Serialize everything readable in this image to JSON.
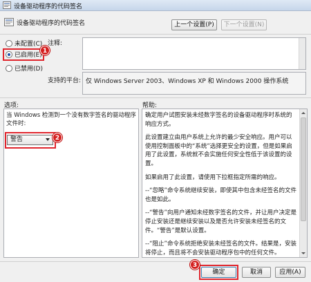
{
  "window": {
    "title": "设备驱动程序的代码签名"
  },
  "header": {
    "title": "设备驱动程序的代码签名",
    "prev_label": "上一个设置(P)",
    "next_label": "下一个设置(N)"
  },
  "state": {
    "options": [
      {
        "label": "未配置(C)",
        "checked": false
      },
      {
        "label": "已启用(E)",
        "checked": true
      },
      {
        "label": "已禁用(D)",
        "checked": false
      }
    ]
  },
  "comment": {
    "label": "注释:",
    "value": ""
  },
  "platform": {
    "label": "支持的平台:",
    "value": "仅 Windows Server 2003、Windows XP 和 Windows 2000 操作系统"
  },
  "options_panel": {
    "label": "选项:",
    "prompt": "当 Windows 检测到一个没有数字签名的驱动程序文件时:",
    "selected": "警告"
  },
  "help_panel": {
    "label": "帮助:",
    "paragraphs": [
      "确定用户试图安装未经数字签名的设备驱动程序时系统的响应方式。",
      "此设置建立由用户系统上允许的最少安全响应。用户可以使用控制面板中的“系统”选择更安全的设置，但是如果启用了此设置，系统就不会实施任何安全性低于该设置的设置。",
      "如果启用了此设置，请使用下拉框指定所需的响应。",
      "--“忽略”命令系统继续安装，即使其中包含未经签名的文件也是如此。",
      "--“警告”向用户通知未经数字签名的文件，并让用户决定是停止安装还是继续安装以及是否允许安装未经签名的文件。“警告”是默认设置。",
      "--“阻止”命令系统拒绝安装未经签名的文件。结果是，安装将停止，而且将不会安装驱动程序包中的任何文件。"
    ]
  },
  "footer": {
    "ok_label": "确定",
    "cancel_label": "取消",
    "apply_label": "应用(A)"
  },
  "badges": {
    "b1": "1",
    "b2": "2",
    "b3": "3"
  },
  "colors": {
    "highlight": "#e0252d",
    "badge": "#d41e1e",
    "titlebar": "#c6d6ea"
  },
  "icons": {
    "window": "policy-icon",
    "header": "policy-icon"
  }
}
